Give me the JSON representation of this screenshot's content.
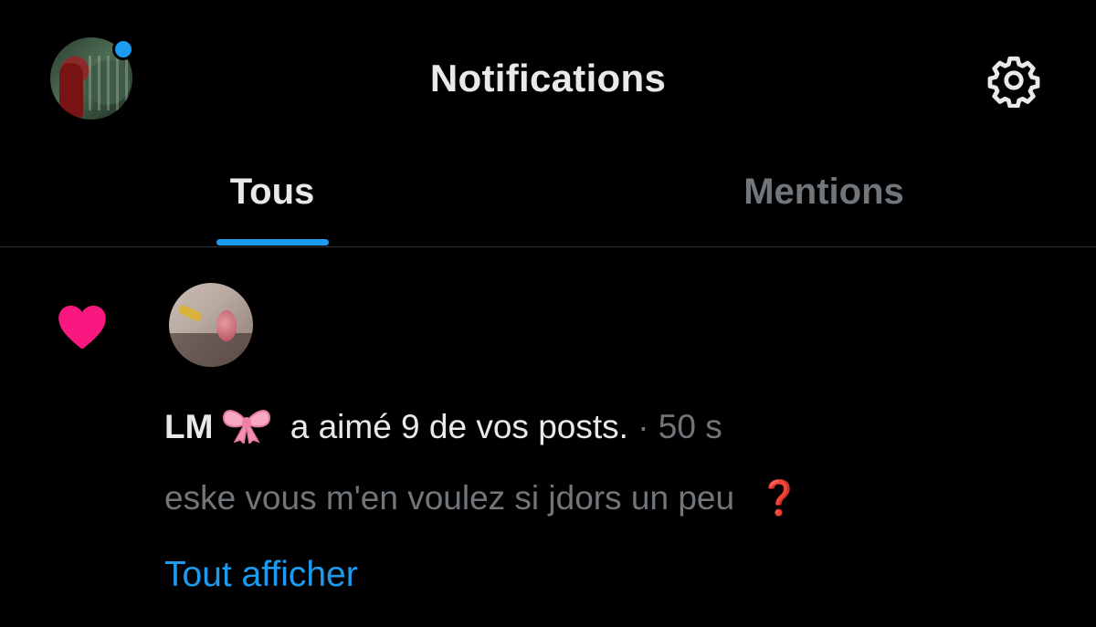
{
  "header": {
    "title": "Notifications",
    "settings_icon": "gear-icon",
    "has_unread_dot": true,
    "accent_color": "#1d9bf0"
  },
  "tabs": [
    {
      "label": "Tous",
      "active": true
    },
    {
      "label": "Mentions",
      "active": false
    }
  ],
  "notification": {
    "type_icon": "heart-icon",
    "type_color": "#f91880",
    "user_name": "LM",
    "user_emoji": "bow-icon",
    "action_text": "a aimé 9 de vos posts.",
    "time": "· 50 s",
    "post_preview": "eske vous m'en voulez si jdors un peu",
    "post_preview_emoji": "❓",
    "show_all_label": "Tout afficher"
  }
}
